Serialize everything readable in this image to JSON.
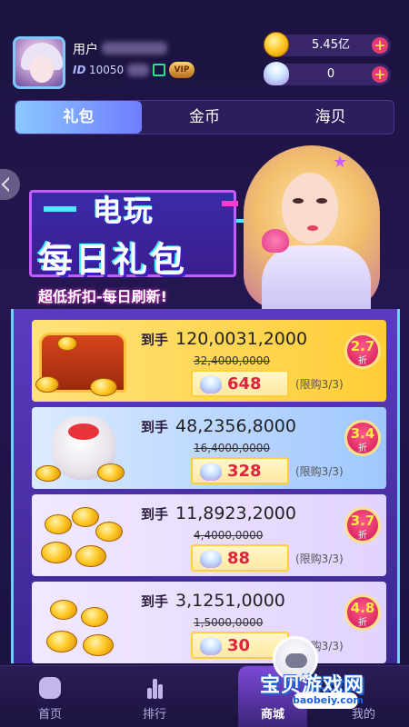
{
  "header": {
    "username": "用户",
    "id_label": "ID",
    "id_value": "10050",
    "vip_badge": "VIP",
    "coins": {
      "amount": "5.45亿",
      "plus": "+"
    },
    "shells": {
      "amount": "0",
      "plus": "+"
    }
  },
  "tabs": [
    {
      "label": "礼包",
      "active": true
    },
    {
      "label": "金币",
      "active": false
    },
    {
      "label": "海贝",
      "active": false
    }
  ],
  "banner": {
    "title_line1": "电玩",
    "title_line2": "每日礼包",
    "subtitle": "超低折扣-每日刷新!"
  },
  "offers": [
    {
      "prefix": "到手",
      "amount": "120,0031,2000",
      "original": "32,4000,0000",
      "price": "648",
      "limit": "(限购3/3)",
      "discount": "2.7",
      "discount_unit": "折"
    },
    {
      "prefix": "到手",
      "amount": "48,2356,8000",
      "original": "16,4000,0000",
      "price": "328",
      "limit": "(限购3/3)",
      "discount": "3.4",
      "discount_unit": "折"
    },
    {
      "prefix": "到手",
      "amount": "11,8923,2000",
      "original": "4,4000,0000",
      "price": "88",
      "limit": "(限购3/3)",
      "discount": "3.7",
      "discount_unit": "折"
    },
    {
      "prefix": "到手",
      "amount": "3,1251,0000",
      "original": "1,5000,0000",
      "price": "30",
      "limit": "(限购3/3)",
      "discount": "4.8",
      "discount_unit": "折"
    }
  ],
  "bottom_nav": [
    {
      "label": "首页",
      "icon": "gamepad-icon",
      "active": false
    },
    {
      "label": "排行",
      "icon": "ranking-icon",
      "active": false
    },
    {
      "label": "商城",
      "icon": "shop-icon",
      "active": true
    },
    {
      "label": "我的",
      "icon": "user-icon",
      "active": false
    }
  ],
  "watermark": {
    "text": "宝贝游戏网",
    "url": "baobeiy.com"
  },
  "colors": {
    "accent_pink": "#e63a79",
    "tab_active": "#8ac8ff",
    "price_red": "#e0233f",
    "background": "#1c1340"
  }
}
